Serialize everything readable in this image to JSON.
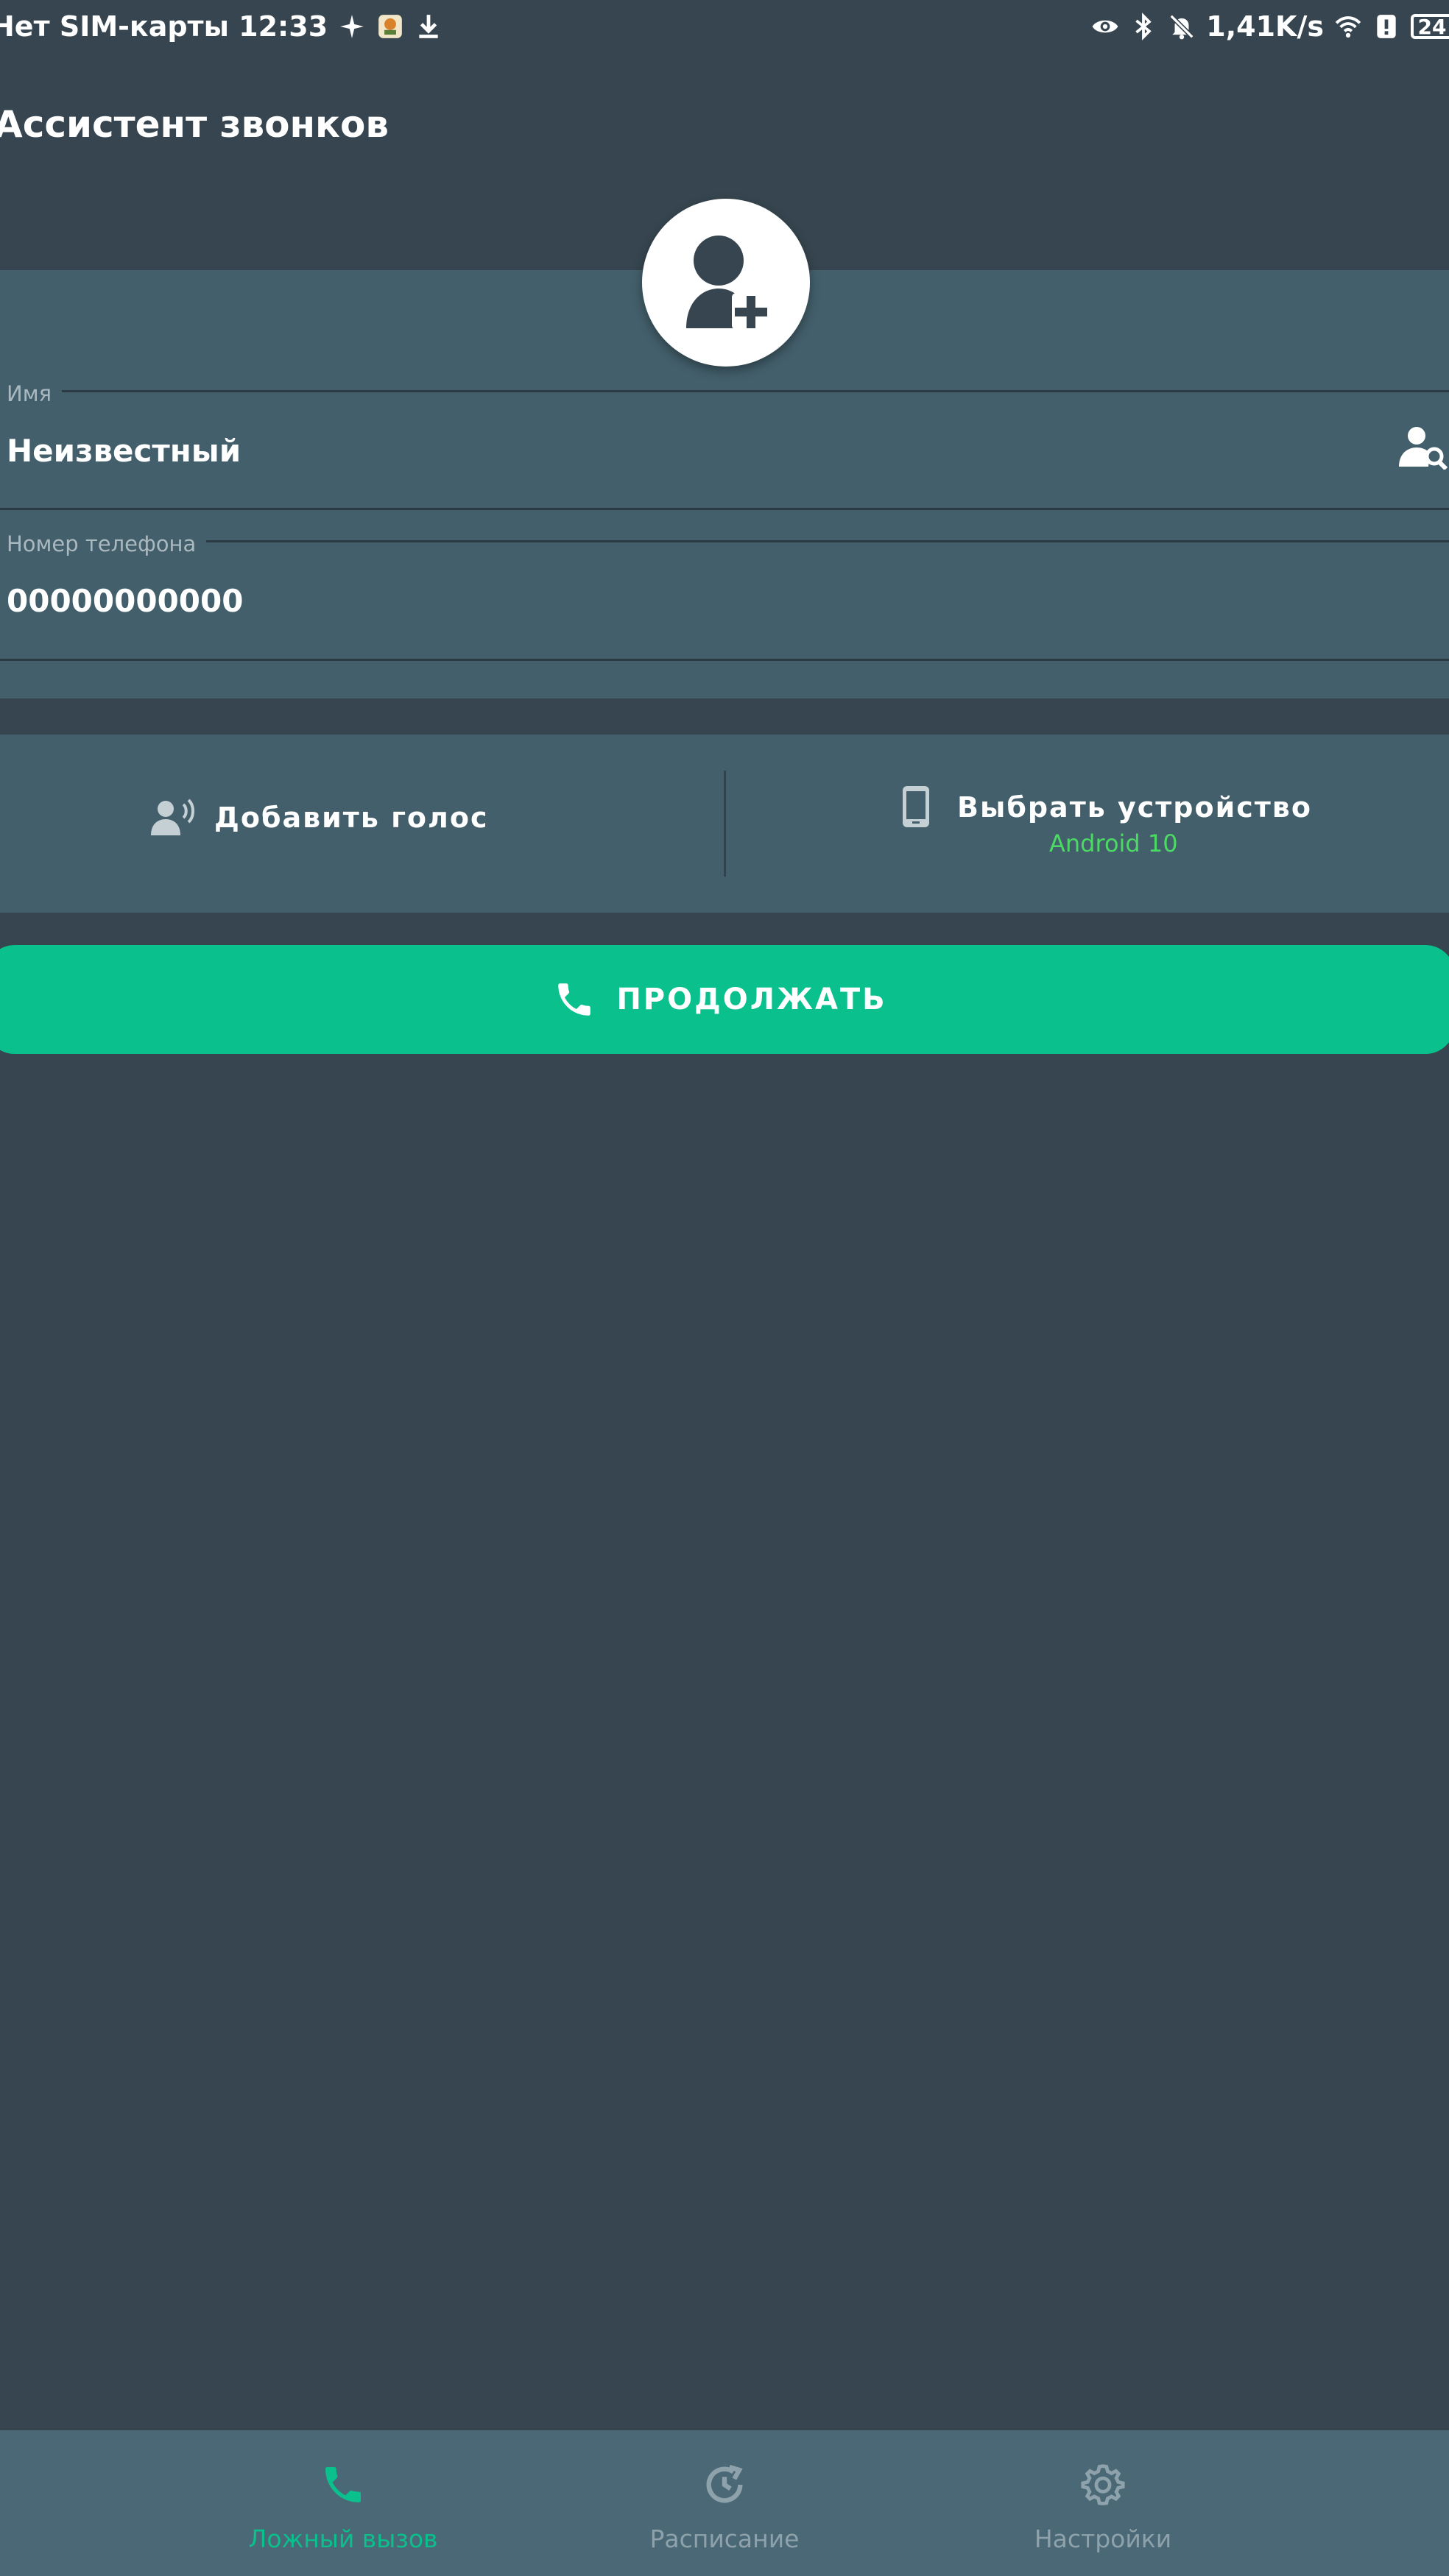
{
  "status_bar": {
    "carrier_time": "Нет SIM-карты 12:33",
    "net_speed": "1,41K/s",
    "battery": "24"
  },
  "app": {
    "title": "Ассистент звонков"
  },
  "form": {
    "name": {
      "label": "Имя",
      "value": "Неизвестный"
    },
    "phone": {
      "label": "Номер телефона",
      "value": "00000000000"
    }
  },
  "actions": {
    "add_voice_label": "Добавить голос",
    "choose_device_label": "Выбрать устройство",
    "device_value": "Android 10"
  },
  "continue_label": "ПРОДОЛЖАТЬ",
  "bottom_nav": {
    "items": [
      {
        "label": "Ложный вызов",
        "icon": "phone-icon",
        "active": true
      },
      {
        "label": "Расписание",
        "icon": "schedule-history-icon",
        "active": false
      },
      {
        "label": "Настройки",
        "icon": "gear-icon",
        "active": false
      }
    ]
  },
  "colors": {
    "background": "#36454f",
    "card": "#435f6b",
    "accent": "#0ac08d",
    "device_status": "#4cd964",
    "bottom_nav": "#4a6875"
  }
}
